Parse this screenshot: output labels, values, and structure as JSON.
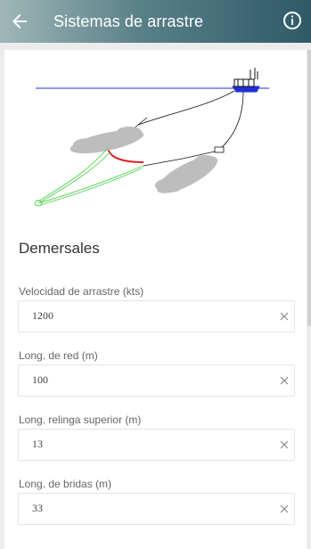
{
  "appbar": {
    "title": "Sistemas de arrastre",
    "back_icon": "arrow-back-icon",
    "info_icon": "info-icon"
  },
  "diagram": {
    "icon": "trawl-system-diagram"
  },
  "section": {
    "title": "Demersales"
  },
  "fields": [
    {
      "label": "Velocidad de arrastre (kts)",
      "value": "1200"
    },
    {
      "label": "Long. de red (m)",
      "value": "100"
    },
    {
      "label": "Long. relinga superior (m)",
      "value": "13"
    },
    {
      "label": "Long. de bridas (m)",
      "value": "33"
    }
  ],
  "colors": {
    "appbar_start": "#9fb7b6",
    "appbar_end": "#2f5a68",
    "waterline": "#1f2fd6",
    "net": "#4bd04b",
    "footrope": "#e02020"
  }
}
